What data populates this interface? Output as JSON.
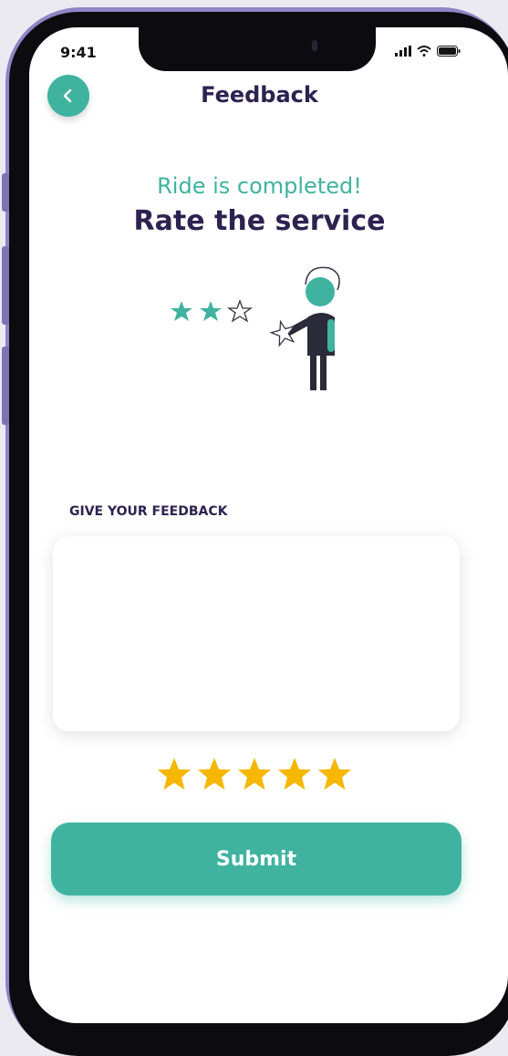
{
  "status_bar": {
    "time": "9:41",
    "signal_icon": "cellular-signal-icon",
    "wifi_icon": "wifi-icon",
    "battery_icon": "battery-icon"
  },
  "header": {
    "title": "Feedback",
    "back_icon": "chevron-left-icon"
  },
  "hero": {
    "subtitle": "Ride is completed!",
    "title": "Rate the service",
    "illustration_icon": "person-holding-star-icon"
  },
  "feedback": {
    "label": "GIVE YOUR FEEDBACK",
    "value": "",
    "placeholder": ""
  },
  "rating": {
    "value": 5,
    "max": 5,
    "star_icon": "star-icon"
  },
  "submit": {
    "label": "Submit"
  },
  "colors": {
    "accent": "#3fb39f",
    "title": "#2d2250",
    "star": "#f6b700",
    "frame": "#8f84c4"
  }
}
